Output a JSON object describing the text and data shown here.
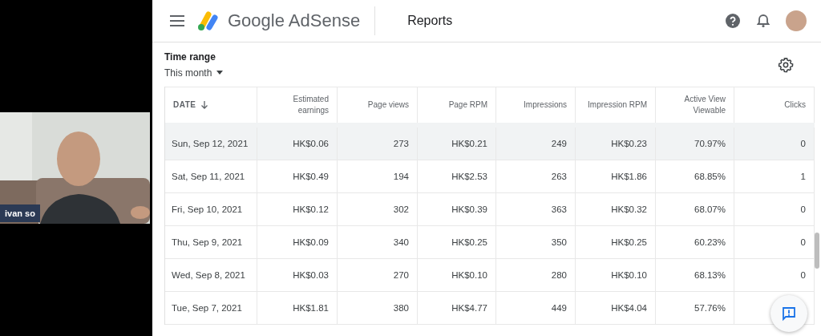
{
  "participant": {
    "name": "ivan so"
  },
  "header": {
    "brand": "Google AdSense",
    "page_title": "Reports"
  },
  "filter": {
    "label": "Time range",
    "value": "This month"
  },
  "table": {
    "columns": [
      {
        "label": "DATE",
        "sorted": true
      },
      {
        "label": "Estimated earnings",
        "sorted": false
      },
      {
        "label": "Page views",
        "sorted": false
      },
      {
        "label": "Page RPM",
        "sorted": false
      },
      {
        "label": "Impressions",
        "sorted": false
      },
      {
        "label": "Impression RPM",
        "sorted": false
      },
      {
        "label": "Active View Viewable",
        "sorted": false
      },
      {
        "label": "Clicks",
        "sorted": false
      }
    ],
    "rows": [
      {
        "highlighted": true,
        "cells": [
          "Sun, Sep 12, 2021",
          "HK$0.06",
          "273",
          "HK$0.21",
          "249",
          "HK$0.23",
          "70.97%",
          "0"
        ]
      },
      {
        "highlighted": false,
        "cells": [
          "Sat, Sep 11, 2021",
          "HK$0.49",
          "194",
          "HK$2.53",
          "263",
          "HK$1.86",
          "68.85%",
          "1"
        ]
      },
      {
        "highlighted": false,
        "cells": [
          "Fri, Sep 10, 2021",
          "HK$0.12",
          "302",
          "HK$0.39",
          "363",
          "HK$0.32",
          "68.07%",
          "0"
        ]
      },
      {
        "highlighted": false,
        "cells": [
          "Thu, Sep 9, 2021",
          "HK$0.09",
          "340",
          "HK$0.25",
          "350",
          "HK$0.25",
          "60.23%",
          "0"
        ]
      },
      {
        "highlighted": false,
        "cells": [
          "Wed, Sep 8, 2021",
          "HK$0.03",
          "270",
          "HK$0.10",
          "280",
          "HK$0.10",
          "68.13%",
          "0"
        ]
      },
      {
        "highlighted": false,
        "cells": [
          "Tue, Sep 7, 2021",
          "HK$1.81",
          "380",
          "HK$4.77",
          "449",
          "HK$4.04",
          "57.76%",
          ""
        ]
      }
    ]
  }
}
